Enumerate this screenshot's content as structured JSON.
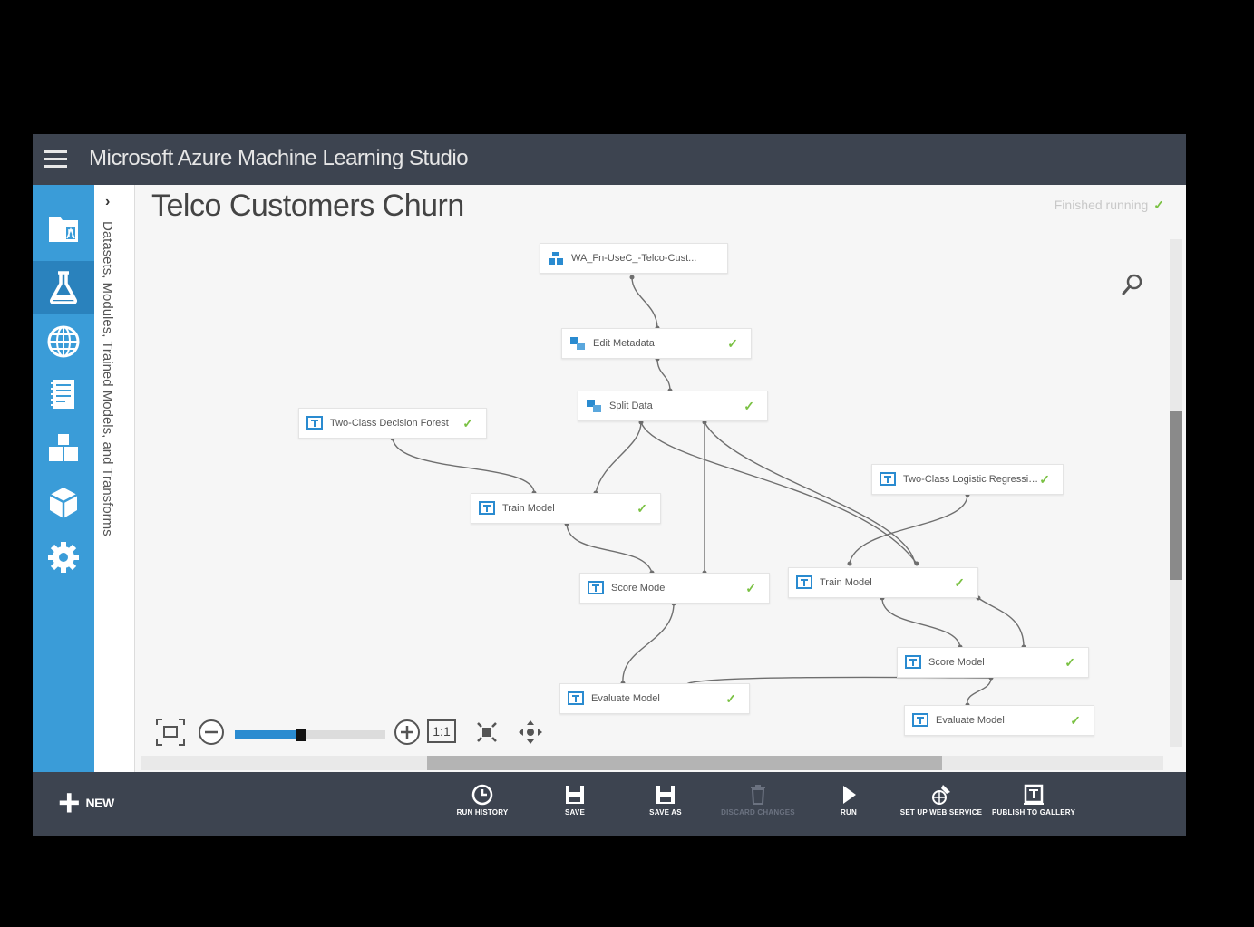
{
  "app": {
    "title": "Microsoft Azure Machine Learning Studio"
  },
  "nav": {
    "items": [
      "projects",
      "experiments",
      "web-services",
      "notebooks",
      "datasets",
      "trained-models",
      "settings"
    ],
    "active": "experiments"
  },
  "palette": {
    "label": "Datasets, Modules, Trained Models, and Transforms"
  },
  "experiment": {
    "title": "Telco Customers Churn",
    "status": "Finished running",
    "status_color": "#7ac143"
  },
  "nodes": [
    {
      "id": "dataset",
      "label": "WA_Fn-UseC_-Telco-Cust...",
      "type": "dataset",
      "done": false
    },
    {
      "id": "edit-metadata",
      "label": "Edit Metadata",
      "type": "transform",
      "done": true
    },
    {
      "id": "split-data",
      "label": "Split Data",
      "type": "transform",
      "done": true
    },
    {
      "id": "decision-forest",
      "label": "Two-Class Decision Forest",
      "type": "model",
      "done": true
    },
    {
      "id": "train-1",
      "label": "Train Model",
      "type": "model",
      "done": true
    },
    {
      "id": "score-1",
      "label": "Score Model",
      "type": "model",
      "done": true
    },
    {
      "id": "evaluate-1",
      "label": "Evaluate Model",
      "type": "model",
      "done": true
    },
    {
      "id": "logistic",
      "label": "Two-Class Logistic Regression",
      "type": "model",
      "done": true
    },
    {
      "id": "train-2",
      "label": "Train Model",
      "type": "model",
      "done": true
    },
    {
      "id": "score-2",
      "label": "Score Model",
      "type": "model",
      "done": true
    },
    {
      "id": "evaluate-2",
      "label": "Evaluate Model",
      "type": "model",
      "done": true
    }
  ],
  "zoom": {
    "level": 0.42,
    "actual_size_label": "1:1"
  },
  "bottom": {
    "new_label": "NEW",
    "commands": [
      {
        "id": "run-history",
        "label": "RUN HISTORY",
        "enabled": true
      },
      {
        "id": "save",
        "label": "SAVE",
        "enabled": true
      },
      {
        "id": "save-as",
        "label": "SAVE AS",
        "enabled": true
      },
      {
        "id": "discard",
        "label": "DISCARD CHANGES",
        "enabled": false
      },
      {
        "id": "run",
        "label": "RUN",
        "enabled": true
      },
      {
        "id": "web-service",
        "label": "SET UP WEB SERVICE",
        "enabled": true
      },
      {
        "id": "publish",
        "label": "PUBLISH TO GALLERY",
        "enabled": true
      }
    ]
  },
  "colors": {
    "topbar": "#3d4450",
    "nav": "#3a9cd8",
    "nav_active": "#2a82bd",
    "check": "#7ac143",
    "accent": "#2a8bd0"
  }
}
